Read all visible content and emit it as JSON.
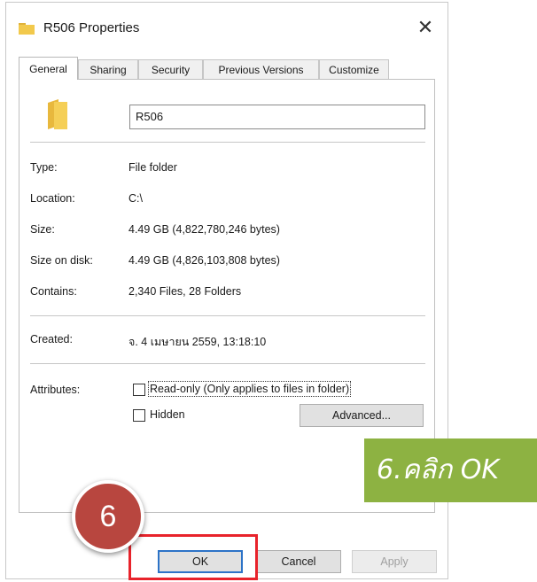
{
  "window": {
    "title": "R506 Properties",
    "close_glyph": "✕"
  },
  "tabs": [
    {
      "label": "General",
      "active": true
    },
    {
      "label": "Sharing",
      "active": false
    },
    {
      "label": "Security",
      "active": false
    },
    {
      "label": "Previous Versions",
      "active": false
    },
    {
      "label": "Customize",
      "active": false
    }
  ],
  "general": {
    "folder_name": "R506",
    "type_label": "Type:",
    "type_value": "File folder",
    "location_label": "Location:",
    "location_value": "C:\\",
    "size_label": "Size:",
    "size_value": "4.49 GB (4,822,780,246 bytes)",
    "size_on_disk_label": "Size on disk:",
    "size_on_disk_value": "4.49 GB (4,826,103,808 bytes)",
    "contains_label": "Contains:",
    "contains_value": "2,340 Files, 28 Folders",
    "created_label": "Created:",
    "created_value": "จ. 4 เมษายน 2559, 13:18:10",
    "attributes_label": "Attributes:",
    "readonly_label": "Read-only (Only applies to files in folder)",
    "readonly_checked": false,
    "hidden_label": "Hidden",
    "hidden_checked": false,
    "advanced_label": "Advanced..."
  },
  "buttons": {
    "ok": "OK",
    "cancel": "Cancel",
    "apply": "Apply"
  },
  "annotation": {
    "step_number": "6",
    "callout_text": "6.คลิก OK"
  },
  "icons": {
    "folder": "folder-icon",
    "close": "close-icon"
  },
  "colors": {
    "folder_yellow": "#f2c94c",
    "highlight_red": "#e8232b",
    "step_circle": "#b8463f",
    "callout_green": "#8db242",
    "ok_focus_blue": "#2c73c7"
  }
}
